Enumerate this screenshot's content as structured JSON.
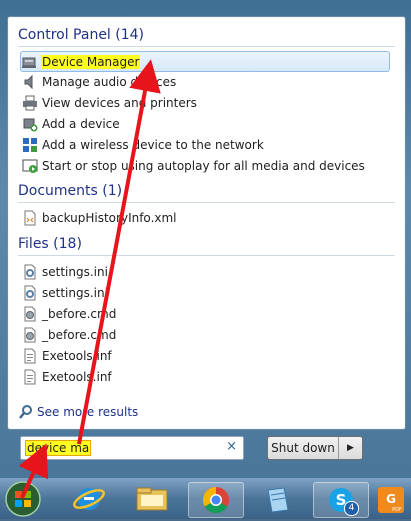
{
  "sections": {
    "control_panel": {
      "header": "Control Panel (14)",
      "items": [
        {
          "label_pre": "",
          "label_hl": "Device Manager",
          "label_post": "",
          "icon": "device-manager-icon"
        },
        {
          "label": "Manage audio devices",
          "icon": "speaker-icon"
        },
        {
          "label": "View devices and printers",
          "icon": "printer-icon"
        },
        {
          "label": "Add a device",
          "icon": "add-device-icon"
        },
        {
          "label": "Add a wireless device to the network",
          "icon": "wireless-network-icon"
        },
        {
          "label": "Start or stop using autoplay for all media and devices",
          "icon": "autoplay-icon"
        }
      ]
    },
    "documents": {
      "header": "Documents (1)",
      "items": [
        {
          "label": "backupHistoryInfo.xml",
          "icon": "xml-file-icon"
        }
      ]
    },
    "files": {
      "header": "Files (18)",
      "items": [
        {
          "label": "settings.ini",
          "icon": "ini-file-icon"
        },
        {
          "label": "settings.ini",
          "icon": "ini-file-icon"
        },
        {
          "label": "_before.cmd",
          "icon": "cmd-file-icon"
        },
        {
          "label": "_before.cmd",
          "icon": "cmd-file-icon"
        },
        {
          "label": "Exetools.inf",
          "icon": "inf-file-icon"
        },
        {
          "label": "Exetools.inf",
          "icon": "inf-file-icon"
        }
      ]
    }
  },
  "see_more": "See more results",
  "search": {
    "value": "device ma",
    "clear": "×"
  },
  "shutdown": {
    "label": "Shut down",
    "arrow": "▶"
  },
  "taskbar": {
    "items": [
      "start-orb-icon",
      "internet-explorer-icon",
      "file-explorer-icon",
      "chrome-icon",
      "notepad-icon",
      "skype-icon",
      "foxit-pdf-icon"
    ],
    "skype_badge": "4"
  },
  "colors": {
    "highlight": "#ffff20",
    "header_blue": "#1e3287",
    "arrow_red": "#e8141c"
  }
}
